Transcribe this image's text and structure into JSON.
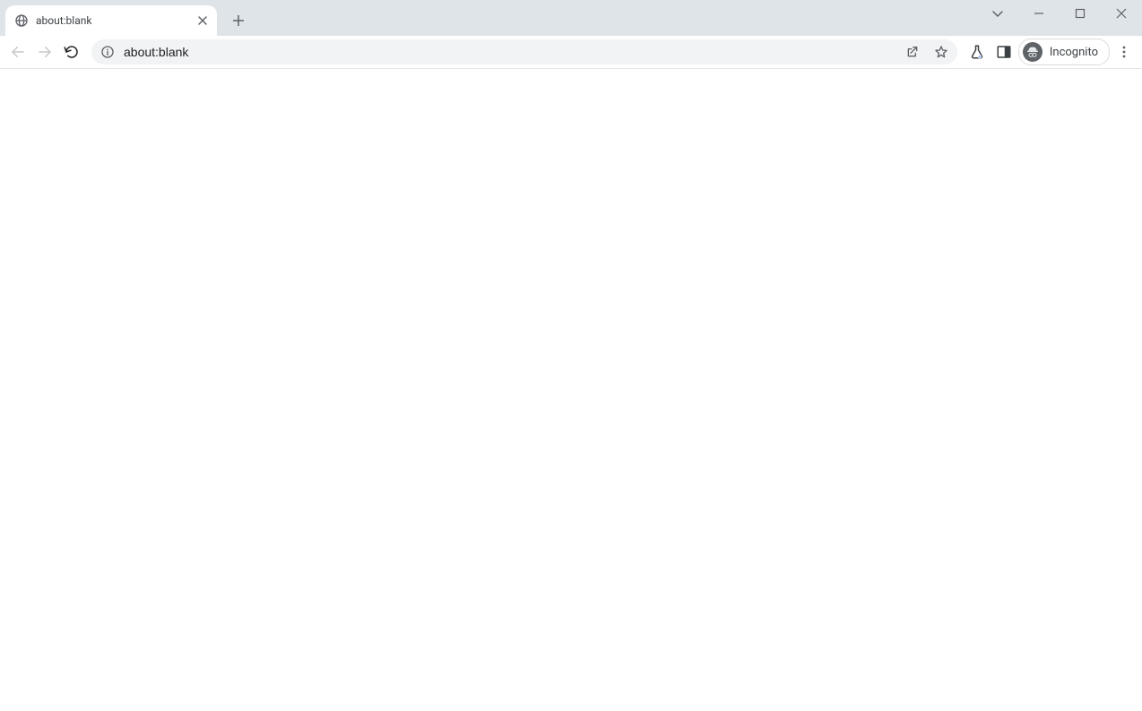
{
  "tabs": [
    {
      "title": "about:blank"
    }
  ],
  "omnibox": {
    "url": "about:blank"
  },
  "profile": {
    "label": "Incognito"
  }
}
